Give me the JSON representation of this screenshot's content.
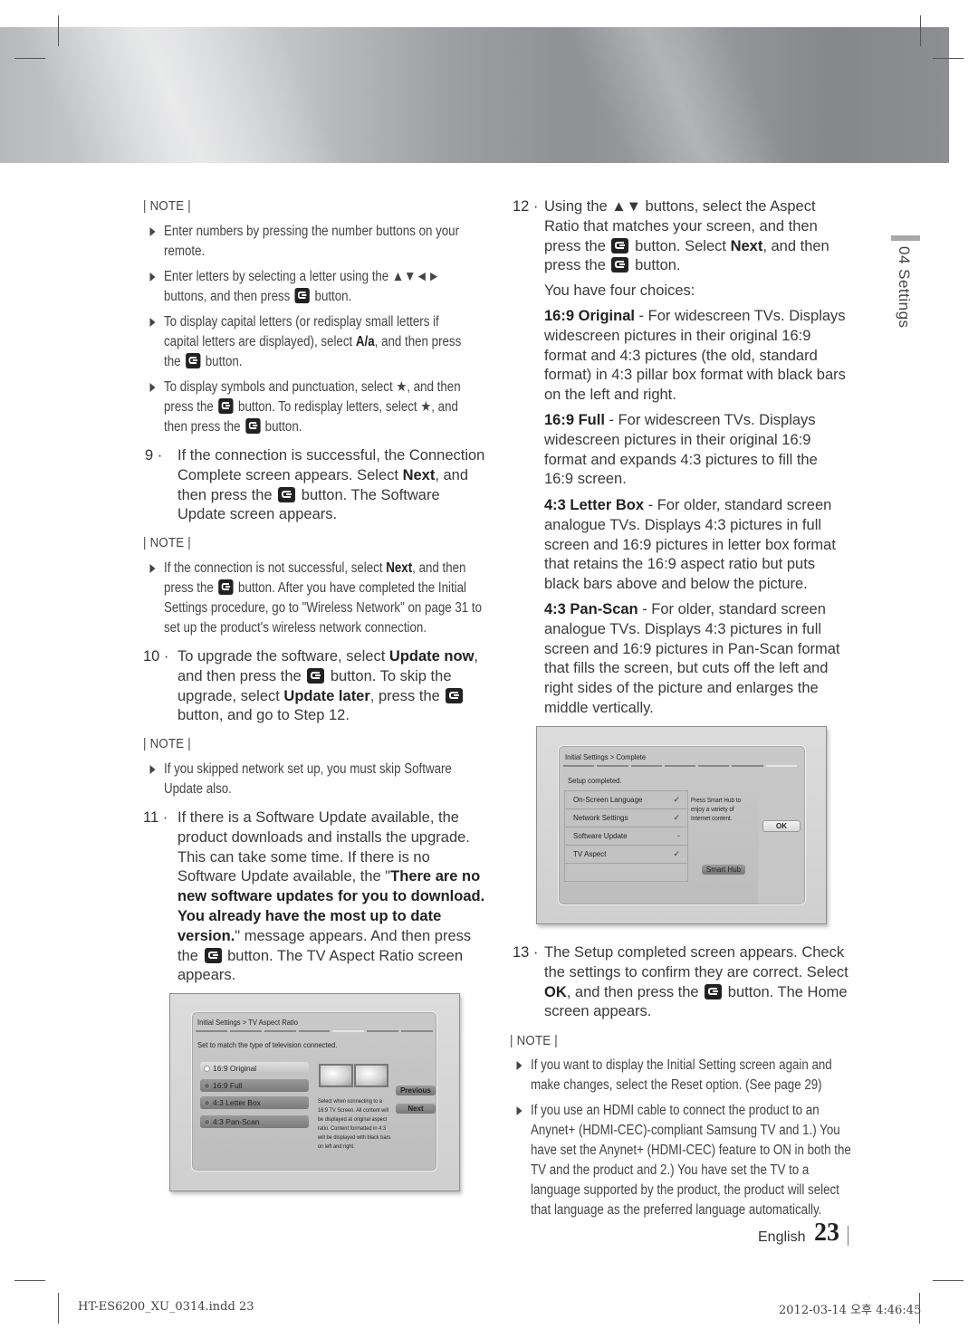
{
  "notes": {
    "heading": "| NOTE |",
    "note1": [
      "Enter numbers by pressing the number buttons on your remote.",
      "Enter letters by selecting a letter using the ▲▼◄► buttons, and then press",
      "button.",
      "To display capital letters (or redisplay small letters if capital letters are displayed), select",
      "A/a",
      ", and then press the",
      "button.",
      "To display symbols and punctuation, select ★, and then press the",
      "button. To redisplay letters, select ★, and then press the",
      "button."
    ],
    "note2": [
      "If the connection is not successful, select",
      "Next",
      ", and then press the",
      "button. After you have completed the Initial Settings procedure, go to \"Wireless Network\" on page 31 to set up the product's wireless network connection."
    ],
    "note3": [
      "If you skipped network set up, you must skip Software Update also."
    ],
    "note4": [
      "If you want to display the Initial Setting screen again and make changes, select the Reset option. (See page 29)",
      "If you use an HDMI cable to connect the product to an Anynet+ (HDMI-CEC)-compliant Samsung TV and 1.) You have set the Anynet+ (HDMI-CEC) feature to ON in both the TV and the product and 2.) You have set the TV to a language supported by the product, the product will select that language as the preferred language automatically."
    ]
  },
  "steps": {
    "s9": {
      "num": "9 ·",
      "t1": "If the connection is successful, the Connection Complete screen appears. Select",
      "b1": "Next",
      "t2": ", and then press the",
      "t3": "button. The Software Update screen appears."
    },
    "s10": {
      "num": "10 ·",
      "t1": "To upgrade the software, select",
      "b1": "Update now",
      "t2": ", and then press the",
      "t3": "button. To skip the upgrade, select",
      "b2": "Update later",
      "t4": ", press the",
      "t5": "button, and go to Step 12."
    },
    "s11": {
      "num": "11 ·",
      "t1": "If there is a Software Update available, the product downloads and installs the upgrade. This can take some time. If there is no Software Update available, the \"",
      "b1": "There are no new software updates for you to download. You already have the most up to date version.",
      "t2": "\" message appears. And then press the",
      "t3": "button. The TV Aspect Ratio screen appears."
    },
    "s12": {
      "num": "12 ·",
      "t1": "Using the ▲▼ buttons, select the Aspect Ratio that matches your screen, and then press the",
      "t2": "button. Select",
      "b1": "Next",
      "t3": ", and then press the",
      "t4": "button."
    },
    "s13": {
      "num": "13 ·",
      "t1": "The Setup completed screen appears. Check the settings to confirm they are correct. Select",
      "b1": "OK",
      "t2": ", and then press the",
      "t3": "button. The Home screen appears."
    }
  },
  "choices": {
    "intro": "You have four choices:",
    "items": [
      {
        "name": "16:9 Original",
        "desc": " - For widescreen TVs. Displays widescreen pictures in their original 16:9 format and 4:3 pictures (the old, standard format) in 4:3 pillar box format with black bars on the left and right."
      },
      {
        "name": "16:9 Full",
        "desc": " - For widescreen TVs. Displays widescreen pictures in their original 16:9 format and expands 4:3 pictures to fill the 16:9 screen."
      },
      {
        "name": "4:3 Letter Box",
        "desc": " - For older, standard screen analogue TVs. Displays 4:3 pictures in full screen and 16:9 pictures in letter box format that retains the 16:9 aspect ratio but puts black bars above and below the picture."
      },
      {
        "name": "4:3 Pan-Scan",
        "desc": " - For older, standard screen analogue TVs. Displays 4:3 pictures in full screen and 16:9 pictures in Pan-Scan format that fills the screen, but cuts off the left and right sides of the picture and enlarges the middle vertically."
      }
    ]
  },
  "aspect_screen": {
    "title": "Initial Settings > TV Aspect Ratio",
    "progress_total": 7,
    "progress_current": 5,
    "subtitle": "Set to match the type of television connected.",
    "options": [
      "16:9 Original",
      "16:9 Full",
      "4:3 Letter Box",
      "4:3 Pan-Scan"
    ],
    "selected": "16:9 Original",
    "description": "Select when connecting to a 16:9 TV Screen. All content will be displayed at original aspect ratio. Content formatted in 4:3 will be displayed with black bars on left and right.",
    "previous": "Previous",
    "next": "Next"
  },
  "complete_screen": {
    "title": "Initial Settings > Complete",
    "progress_total": 7,
    "progress_current": 7,
    "subtitle": "Setup completed.",
    "rows": [
      {
        "label": "On-Screen Language",
        "status": "✓"
      },
      {
        "label": "Network Settings",
        "status": "✓"
      },
      {
        "label": "Software Update",
        "status": "-"
      },
      {
        "label": "TV Aspect",
        "status": "✓"
      }
    ],
    "hint": "Press Smart Hub to enjoy a variety of Internet content.",
    "smart_hub": "Smart Hub",
    "ok": "OK"
  },
  "side_tab": {
    "label": "04  Settings"
  },
  "footer": {
    "language": "English",
    "page": "23",
    "file": "HT-ES6200_XU_0314.indd   23",
    "timestamp": "2012-03-14   오후 4:46:45"
  }
}
